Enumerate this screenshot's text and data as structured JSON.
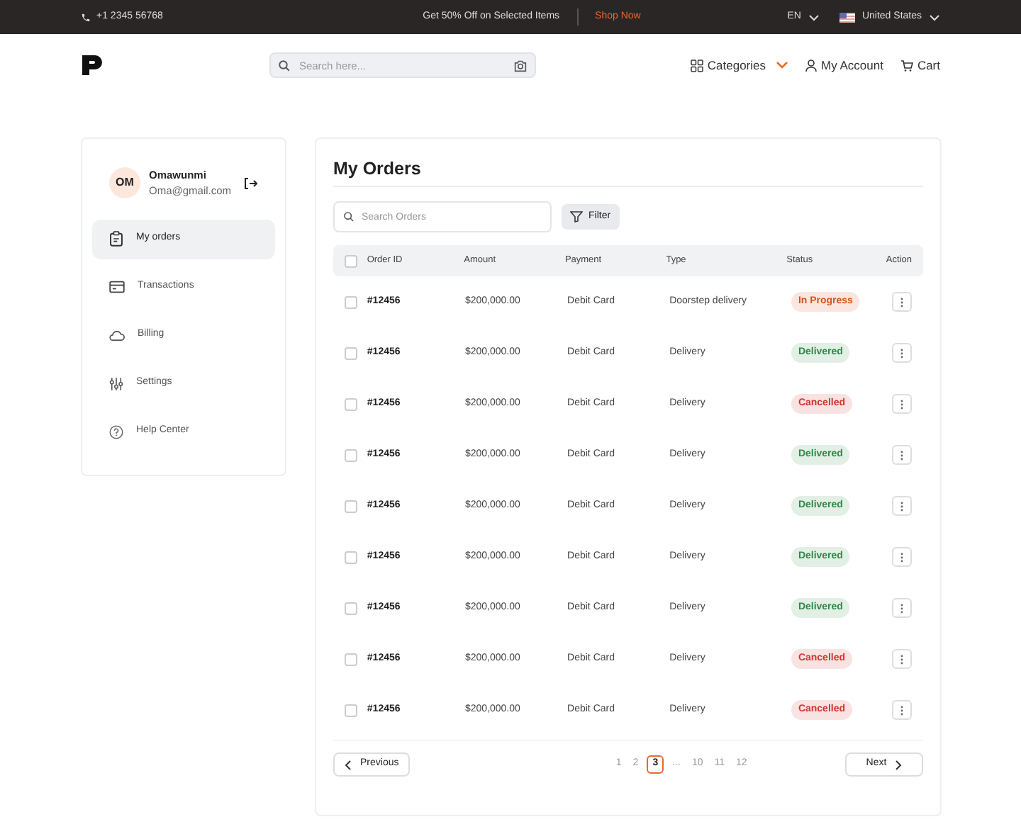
{
  "top_bar": {
    "phone": "+1 2345 56768",
    "promo": "Get 50% Off on Selected Items",
    "promo_link": "Shop Now",
    "language": "EN",
    "country": "United States"
  },
  "header": {
    "search": {
      "placeholder": "Search here..."
    },
    "nav": [
      "Categories",
      "My Account",
      "Cart"
    ]
  },
  "profile": {
    "initials": "OM",
    "name": "Omawunmi",
    "email": "Oma@gmail.com"
  },
  "sidebar": {
    "items": [
      {
        "label": "My orders",
        "selected": true
      },
      {
        "label": "Transactions",
        "selected": false
      },
      {
        "label": "Billing",
        "selected": false
      },
      {
        "label": "Settings",
        "selected": false
      },
      {
        "label": "Help Center",
        "selected": false
      }
    ]
  },
  "orders": {
    "title": "My Orders",
    "search": {
      "placeholder": "Search Orders"
    },
    "filter_button": "Filter",
    "select_all_checked": false,
    "columns": [
      "Order ID",
      "Amount",
      "Payment",
      "Type",
      "Status",
      "Action"
    ],
    "rows": [
      {
        "id": "#12456",
        "amount": "$200,000.00",
        "payment": "Debit Card",
        "type": "Doorstep delivery",
        "status": "In Progress",
        "color": "#d4531c",
        "checked": false
      },
      {
        "id": "#12456",
        "amount": "$200,000.00",
        "payment": "Debit Card",
        "type": "Delivery",
        "status": "Delivered",
        "color": "#2e8a48",
        "checked": false
      },
      {
        "id": "#12456",
        "amount": "$200,000.00",
        "payment": "Debit Card",
        "type": "Delivery",
        "status": "Cancelled",
        "color": "#d1352f",
        "checked": false
      },
      {
        "id": "#12456",
        "amount": "$200,000.00",
        "payment": "Debit Card",
        "type": "Delivery",
        "status": "Delivered",
        "color": "#2e8a48",
        "checked": false
      },
      {
        "id": "#12456",
        "amount": "$200,000.00",
        "payment": "Debit Card",
        "type": "Delivery",
        "status": "Delivered",
        "color": "#2e8a48",
        "checked": false
      },
      {
        "id": "#12456",
        "amount": "$200,000.00",
        "payment": "Debit Card",
        "type": "Delivery",
        "status": "Delivered",
        "color": "#2e8a48",
        "checked": false
      },
      {
        "id": "#12456",
        "amount": "$200,000.00",
        "payment": "Debit Card",
        "type": "Delivery",
        "status": "Delivered",
        "color": "#2e8a48",
        "checked": false
      },
      {
        "id": "#12456",
        "amount": "$200,000.00",
        "payment": "Debit Card",
        "type": "Delivery",
        "status": "Cancelled",
        "color": "#d1352f",
        "checked": false
      },
      {
        "id": "#12456",
        "amount": "$200,000.00",
        "payment": "Debit Card",
        "type": "Delivery",
        "status": "Cancelled",
        "color": "#d1352f",
        "checked": false
      }
    ]
  },
  "pagination": {
    "previous": "Previous",
    "next": "Next",
    "pages": [
      {
        "label": "1",
        "selected": false
      },
      {
        "label": "2",
        "selected": false
      },
      {
        "label": "3",
        "selected": true
      },
      {
        "label": "...",
        "selected": false
      },
      {
        "label": "10",
        "selected": false
      },
      {
        "label": "11",
        "selected": false
      },
      {
        "label": "12",
        "selected": false
      }
    ]
  }
}
